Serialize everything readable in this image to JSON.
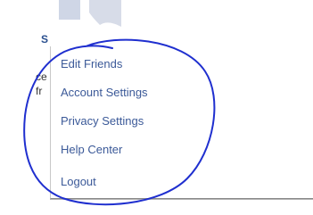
{
  "background": {
    "fragment_s": "S",
    "fragment_ce": "ce",
    "fragment_fr": "fr"
  },
  "menu": {
    "items": [
      {
        "label": "Edit Friends"
      },
      {
        "label": "Account Settings"
      },
      {
        "label": "Privacy Settings"
      },
      {
        "label": "Help Center"
      },
      {
        "label": "Logout"
      }
    ]
  },
  "colors": {
    "link": "#3b5998",
    "annotation": "#1f2fcf"
  }
}
